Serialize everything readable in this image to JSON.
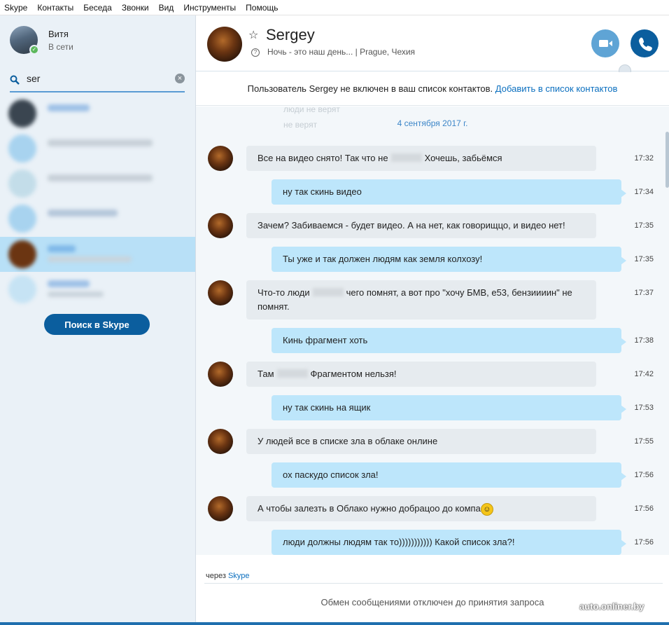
{
  "menu": [
    "Skype",
    "Контакты",
    "Беседа",
    "Звонки",
    "Вид",
    "Инструменты",
    "Помощь"
  ],
  "me": {
    "name": "Витя",
    "status": "В сети"
  },
  "search": {
    "value": "ser"
  },
  "sidebar": {
    "skype_search_label": "Поиск в Skype"
  },
  "contact": {
    "name": "Sergey",
    "mood": "Ночь - это наш день... | Prague, Чехия"
  },
  "notice": {
    "text": "Пользователь Sergey не включен в ваш список контактов. ",
    "link": "Добавить в список контактов"
  },
  "chat": {
    "faded_lines": [
      "люди не верят",
      "не верят"
    ],
    "date": "4 сентября 2017 г.",
    "messages": [
      {
        "dir": "in",
        "text_before": "Все на видео снято! Так что не",
        "text_after": "Хочешь, забьёмся",
        "time": "17:32"
      },
      {
        "dir": "out",
        "text": "ну так скинь видео",
        "time": "17:34"
      },
      {
        "dir": "in",
        "text": "Зачем? Забиваемся - будет видео. А на нет, как говорищцо, и видео нет!",
        "time": "17:35"
      },
      {
        "dir": "out",
        "text": "Ты уже и так должен людям как земля колхозу!",
        "time": "17:35"
      },
      {
        "dir": "in",
        "text_before": "Что-то люди",
        "text_after": "чего помнят, а вот про \"хочу БМВ, е53, бензиииин\" не помнят.",
        "time": "17:37"
      },
      {
        "dir": "out",
        "text": "Кинь фрагмент хоть",
        "time": "17:38"
      },
      {
        "dir": "in",
        "text_before": "Там",
        "text_after": "Фрагментом нельзя!",
        "time": "17:42"
      },
      {
        "dir": "out",
        "text": "ну так скинь на ящик",
        "time": "17:53"
      },
      {
        "dir": "in",
        "text": "У людей все в списке зла в облаке онлине",
        "time": "17:55"
      },
      {
        "dir": "out",
        "text": "ох паскудо список зла!",
        "time": "17:56"
      },
      {
        "dir": "in",
        "text": "А чтобы залезть в Облако нужно добрацоо до компа",
        "time": "17:56"
      },
      {
        "dir": "out",
        "text": "люди должны  людям так  то))))))))))) Какой список зла?!",
        "time": "17:56"
      }
    ]
  },
  "via": {
    "prefix": "через ",
    "link": "Skype"
  },
  "footer": {
    "text": "Обмен сообщениями отключен до принятия запроса"
  },
  "watermark": "auto.onliner.by"
}
